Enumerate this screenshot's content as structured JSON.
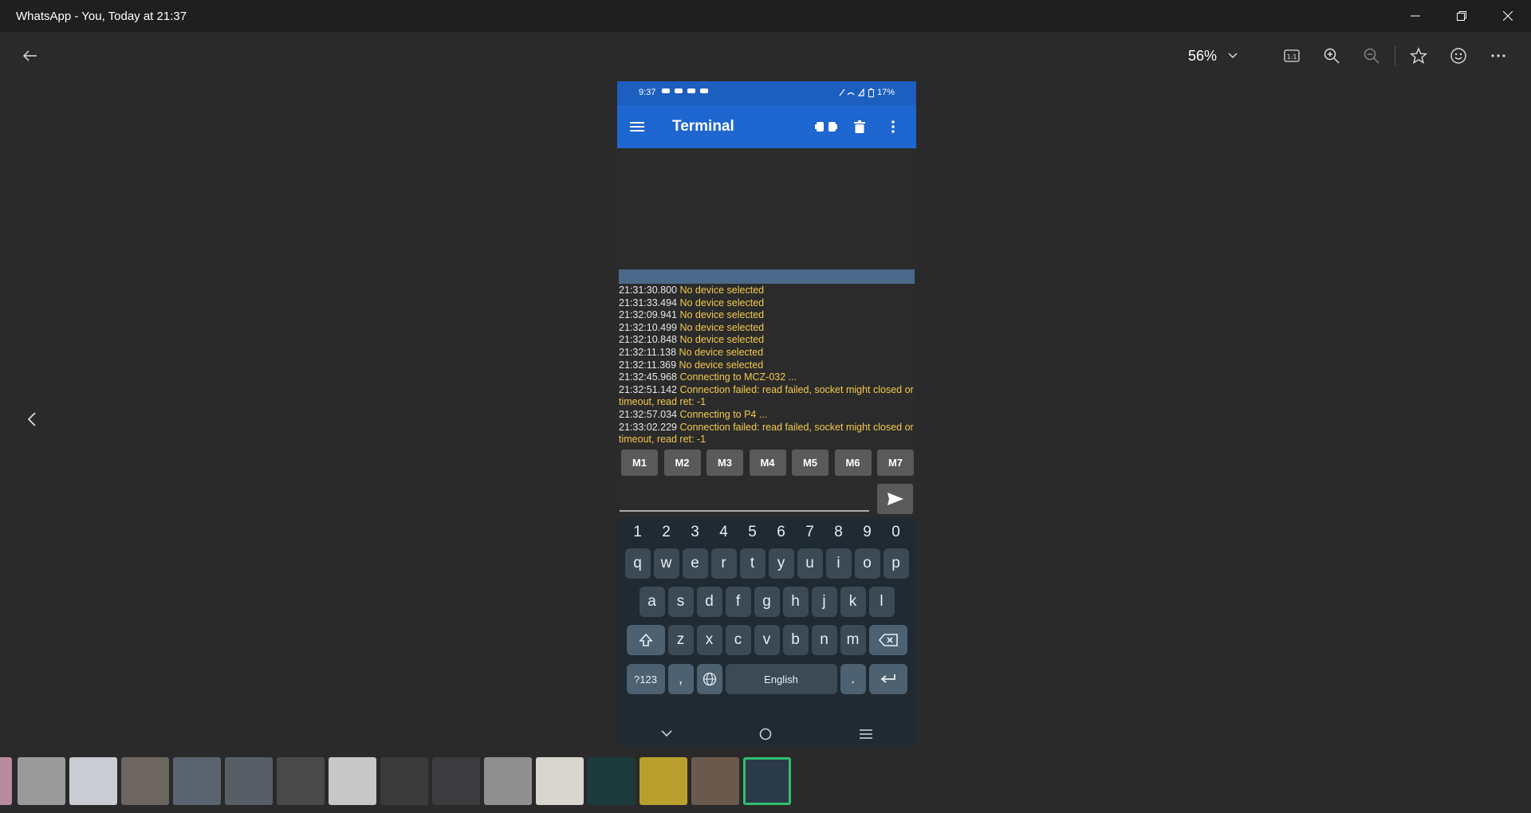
{
  "window": {
    "title": "WhatsApp - You, Today at 21:37"
  },
  "toolbar": {
    "zoom": "56%"
  },
  "phone": {
    "status_time": "9:37",
    "battery": "17%",
    "app_title": "Terminal",
    "log": [
      {
        "ts": "21:31:30.800",
        "msg": "No device selected"
      },
      {
        "ts": "21:31:33.494",
        "msg": "No device selected"
      },
      {
        "ts": "21:32:09.941",
        "msg": "No device selected"
      },
      {
        "ts": "21:32:10.499",
        "msg": "No device selected"
      },
      {
        "ts": "21:32:10.848",
        "msg": "No device selected"
      },
      {
        "ts": "21:32:11.138",
        "msg": "No device selected"
      },
      {
        "ts": "21:32:11.369",
        "msg": "No device selected"
      },
      {
        "ts": "21:32:45.968",
        "msg": "Connecting to MCZ-032 ..."
      },
      {
        "ts": "21:32:51.142",
        "msg": "Connection failed: read failed, socket might closed or timeout, read ret: -1"
      },
      {
        "ts": "21:32:57.034",
        "msg": "Connecting to P4 ..."
      },
      {
        "ts": "21:33:02.229",
        "msg": "Connection failed: read failed, socket might closed or timeout, read ret: -1"
      }
    ],
    "macros": [
      "M1",
      "M2",
      "M3",
      "M4",
      "M5",
      "M6",
      "M7"
    ],
    "keyboard": {
      "numbers": [
        "1",
        "2",
        "3",
        "4",
        "5",
        "6",
        "7",
        "8",
        "9",
        "0"
      ],
      "row1": [
        "q",
        "w",
        "e",
        "r",
        "t",
        "y",
        "u",
        "i",
        "o",
        "p"
      ],
      "row2": [
        "a",
        "s",
        "d",
        "f",
        "g",
        "h",
        "j",
        "k",
        "l"
      ],
      "row3": [
        "z",
        "x",
        "c",
        "v",
        "b",
        "n",
        "m"
      ],
      "symbols_key": "?123",
      "comma": ",",
      "space_label": "English",
      "period": "."
    }
  },
  "colors": {
    "accent": "#1e66d0",
    "log_text": "#f2c94c",
    "selected_thumb": "#2fbf71"
  },
  "icons": [
    "back-arrow-icon",
    "chevron-down-icon",
    "actual-size-icon",
    "zoom-in-icon",
    "zoom-out-icon",
    "star-icon",
    "emoji-icon",
    "more-icon",
    "minimize-icon",
    "restore-icon",
    "close-icon",
    "prev-arrow-icon",
    "menu-icon",
    "connect-icon",
    "trash-icon",
    "kebab-icon",
    "send-icon",
    "shift-icon",
    "backspace-icon",
    "globe-icon",
    "enter-icon"
  ]
}
